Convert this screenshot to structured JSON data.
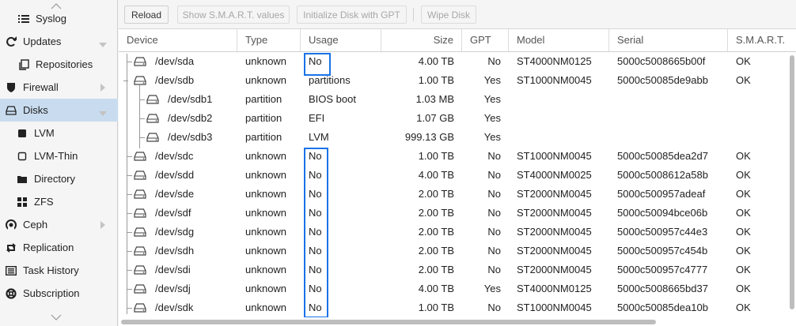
{
  "sidebar": {
    "items": [
      {
        "label": "Syslog",
        "icon": "list-icon"
      },
      {
        "label": "Updates",
        "icon": "refresh-icon"
      },
      {
        "label": "Repositories",
        "icon": "copy-icon"
      },
      {
        "label": "Firewall",
        "icon": "shield-icon"
      },
      {
        "label": "Disks",
        "icon": "hdd-icon"
      },
      {
        "label": "LVM",
        "icon": "square-filled-icon"
      },
      {
        "label": "LVM-Thin",
        "icon": "square-outline-icon"
      },
      {
        "label": "Directory",
        "icon": "folder-icon"
      },
      {
        "label": "ZFS",
        "icon": "th-large-icon"
      },
      {
        "label": "Ceph",
        "icon": "ceph-icon"
      },
      {
        "label": "Replication",
        "icon": "retweet-icon"
      },
      {
        "label": "Task History",
        "icon": "list-alt-icon"
      },
      {
        "label": "Subscription",
        "icon": "support-icon"
      }
    ],
    "selected": "Disks"
  },
  "toolbar": {
    "reload": "Reload",
    "smart": "Show S.M.A.R.T. values",
    "init_gpt": "Initialize Disk with GPT",
    "wipe": "Wipe Disk"
  },
  "grid": {
    "columns": [
      "Device",
      "Type",
      "Usage",
      "Size",
      "GPT",
      "Model",
      "Serial",
      "S.M.A.R.T."
    ],
    "rows": [
      {
        "device": "/dev/sda",
        "type": "unknown",
        "usage": "No",
        "size": "4.00 TB",
        "gpt": "No",
        "model": "ST4000NM0125",
        "serial": "5000c5008665b00f",
        "smart": "OK"
      },
      {
        "device": "/dev/sdb",
        "type": "unknown",
        "usage": "partitions",
        "size": "1.00 TB",
        "gpt": "Yes",
        "model": "ST1000NM0045",
        "serial": "5000c50085de9abb",
        "smart": "OK"
      },
      {
        "device": "/dev/sdb1",
        "type": "partition",
        "usage": "BIOS boot",
        "size": "1.03 MB",
        "gpt": "Yes",
        "model": "",
        "serial": "",
        "smart": ""
      },
      {
        "device": "/dev/sdb2",
        "type": "partition",
        "usage": "EFI",
        "size": "1.07 GB",
        "gpt": "Yes",
        "model": "",
        "serial": "",
        "smart": ""
      },
      {
        "device": "/dev/sdb3",
        "type": "partition",
        "usage": "LVM",
        "size": "999.13 GB",
        "gpt": "Yes",
        "model": "",
        "serial": "",
        "smart": ""
      },
      {
        "device": "/dev/sdc",
        "type": "unknown",
        "usage": "No",
        "size": "1.00 TB",
        "gpt": "No",
        "model": "ST1000NM0045",
        "serial": "5000c50085dea2d7",
        "smart": "OK"
      },
      {
        "device": "/dev/sdd",
        "type": "unknown",
        "usage": "No",
        "size": "4.00 TB",
        "gpt": "No",
        "model": "ST4000NM0025",
        "serial": "5000c5008612a58b",
        "smart": "OK"
      },
      {
        "device": "/dev/sde",
        "type": "unknown",
        "usage": "No",
        "size": "2.00 TB",
        "gpt": "No",
        "model": "ST2000NM0045",
        "serial": "5000c500957adeaf",
        "smart": "OK"
      },
      {
        "device": "/dev/sdf",
        "type": "unknown",
        "usage": "No",
        "size": "2.00 TB",
        "gpt": "No",
        "model": "ST2000NM0045",
        "serial": "5000c50094bce06b",
        "smart": "OK"
      },
      {
        "device": "/dev/sdg",
        "type": "unknown",
        "usage": "No",
        "size": "2.00 TB",
        "gpt": "No",
        "model": "ST2000NM0045",
        "serial": "5000c500957c44e3",
        "smart": "OK"
      },
      {
        "device": "/dev/sdh",
        "type": "unknown",
        "usage": "No",
        "size": "2.00 TB",
        "gpt": "No",
        "model": "ST2000NM0045",
        "serial": "5000c500957c454b",
        "smart": "OK"
      },
      {
        "device": "/dev/sdi",
        "type": "unknown",
        "usage": "No",
        "size": "2.00 TB",
        "gpt": "No",
        "model": "ST2000NM0045",
        "serial": "5000c500957c4777",
        "smart": "OK"
      },
      {
        "device": "/dev/sdj",
        "type": "unknown",
        "usage": "No",
        "size": "4.00 TB",
        "gpt": "Yes",
        "model": "ST4000NM0125",
        "serial": "5000c5008665bd37",
        "smart": "OK"
      },
      {
        "device": "/dev/sdk",
        "type": "unknown",
        "usage": "No",
        "size": "1.00 TB",
        "gpt": "No",
        "model": "ST1000NM0045",
        "serial": "5000c50085dea10b",
        "smart": "OK"
      }
    ]
  },
  "colors": {
    "selected_bg": "#c9dcef",
    "highlight": "#1a73e8"
  }
}
